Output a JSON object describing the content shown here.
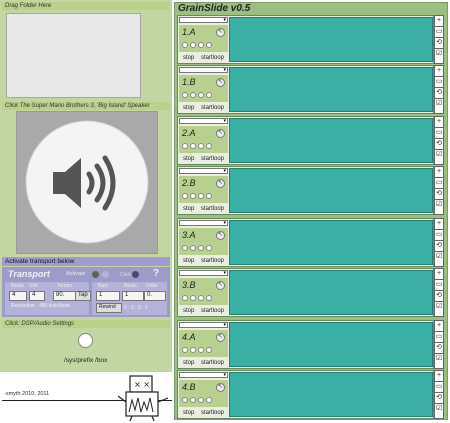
{
  "left": {
    "drag_title": "Drag Folder Here",
    "speaker_title": "Click The Super Mario Brothers 3, 'Big Island' Speaker",
    "transport_bar": "Activate transport below",
    "transport": {
      "title": "Transport",
      "activate_label": "Activate",
      "click_label": "Click",
      "help": "?",
      "beats_label": "Beats",
      "unit_label": "Unit",
      "tempo_label": "Tempo",
      "beats": "4",
      "unit": "4",
      "tempo": "80.",
      "tap": "Tap",
      "resolution": "Resolution - 480 ticks/beat",
      "bars_label": "Bars",
      "beats2_label": "Beats",
      "units_label": "Units",
      "bars": "1",
      "beats2": "1",
      "units": "0.",
      "rewind": "Rewind",
      "position": "0 : 0 : 0 : 0"
    },
    "dsp_title": "Click: DSP/Audio Settings",
    "dsp_path": "/sys/prefix /box",
    "credit": "-smyth 2010, 2011"
  },
  "grainslide": {
    "title": "GrainSlide v0.5",
    "tracks": [
      {
        "name": "1.A",
        "stop": "stop",
        "start": "startloop"
      },
      {
        "name": "1.B",
        "stop": "stop",
        "start": "startloop"
      },
      {
        "name": "2.A",
        "stop": "stop",
        "start": "startloop"
      },
      {
        "name": "2.B",
        "stop": "stop",
        "start": "startloop"
      },
      {
        "name": "3.A",
        "stop": "stop",
        "start": "startloop"
      },
      {
        "name": "3.B",
        "stop": "stop",
        "start": "startloop"
      },
      {
        "name": "4.A",
        "stop": "stop",
        "start": "startloop"
      },
      {
        "name": "4.B",
        "stop": "stop",
        "start": "startloop"
      }
    ]
  },
  "colors": {
    "accent_green": "#b9d18a",
    "wave_teal": "#3ab0a4",
    "transport_purple": "#9d9bc9"
  }
}
